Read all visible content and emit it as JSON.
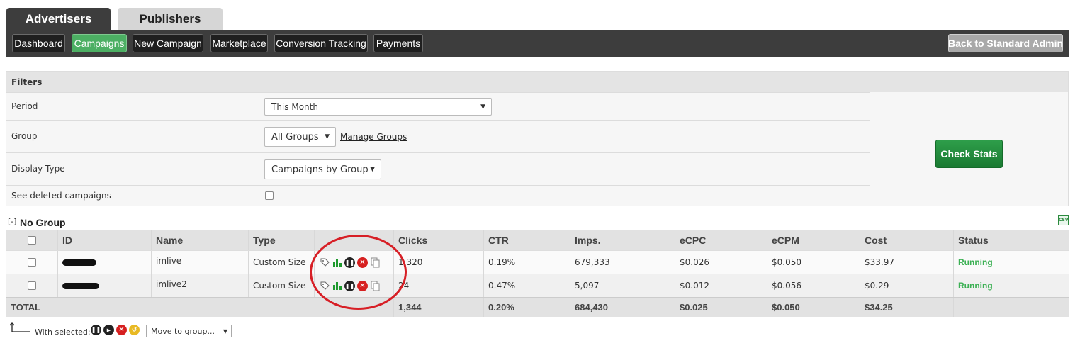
{
  "tabs": {
    "advertisers": "Advertisers",
    "publishers": "Publishers"
  },
  "nav": {
    "items": [
      "Dashboard",
      "Campaigns",
      "New Campaign",
      "Marketplace",
      "Conversion Tracking",
      "Payments"
    ],
    "active": "Campaigns",
    "back": "Back to Standard Admin"
  },
  "filters": {
    "title": "Filters",
    "period_label": "Period",
    "period_value": "This Month",
    "group_label": "Group",
    "group_value": "All Groups",
    "manage_groups": "Manage Groups",
    "display_type_label": "Display Type",
    "display_type_value": "Campaigns by Group",
    "deleted_label": "See deleted campaigns",
    "check_stats": "Check Stats"
  },
  "group": {
    "toggle": "[-]",
    "title": "No Group",
    "export_icon": "csv-export-icon"
  },
  "table": {
    "headers": {
      "id": "ID",
      "name": "Name",
      "type": "Type",
      "clicks": "Clicks",
      "ctr": "CTR",
      "imps": "Imps.",
      "ecpc": "eCPC",
      "ecpm": "eCPM",
      "cost": "Cost",
      "status": "Status"
    },
    "rows": [
      {
        "name": "imlive",
        "type": "Custom Size",
        "clicks": "1,320",
        "ctr": "0.19%",
        "imps": "679,333",
        "ecpc": "$0.026",
        "ecpm": "$0.050",
        "cost": "$33.97",
        "status": "Running"
      },
      {
        "name": "imlive2",
        "type": "Custom Size",
        "clicks": "24",
        "ctr": "0.47%",
        "imps": "5,097",
        "ecpc": "$0.012",
        "ecpm": "$0.056",
        "cost": "$0.29",
        "status": "Running"
      }
    ],
    "total": {
      "label": "TOTAL",
      "clicks": "1,344",
      "ctr": "0.20%",
      "imps": "684,430",
      "ecpc": "$0.025",
      "ecpm": "$0.050",
      "cost": "$34.25"
    },
    "row_icons": [
      "tag-icon",
      "stats-icon",
      "pause-icon",
      "delete-icon",
      "copy-icon"
    ]
  },
  "footer": {
    "with_selected": "With selected:",
    "move_to_group": "Move to group...",
    "icons": [
      "pause-icon",
      "play-icon",
      "delete-icon",
      "restore-icon"
    ]
  },
  "colors": {
    "nav_bg": "#3d3d3d",
    "active": "#4caf63",
    "running": "#3cb054",
    "check_stats": "#1f8a3a",
    "highlight_circle": "#d71f26"
  }
}
